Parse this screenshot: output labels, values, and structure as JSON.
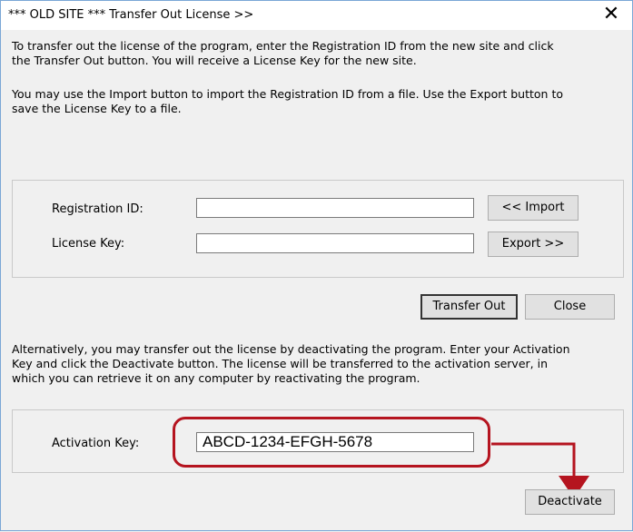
{
  "window": {
    "title": "*** OLD SITE ***  Transfer Out License >>",
    "close_glyph": "✕"
  },
  "intro": {
    "line1": "To transfer out the license of the program, enter the Registration ID from the new site and click",
    "line2": "the Transfer Out button. You will receive a License Key for the new site.",
    "line3": "You may use the Import button to import the Registration ID from a file. Use the Export button to",
    "line4": "save the License Key to a file."
  },
  "transfer_group": {
    "registration_label": "Registration ID:",
    "registration_value": "",
    "license_label": "License Key:",
    "license_value": "",
    "import_label": "<< Import",
    "export_label": "Export >>"
  },
  "actions": {
    "transfer_out_label": "Transfer Out",
    "close_label": "Close"
  },
  "alternative": {
    "line1": "Alternatively, you may transfer out the license by deactivating the program. Enter your Activation",
    "line2": "Key and click the Deactivate button. The license will be transferred to the activation server, in",
    "line3": "which you can retrieve it on any computer by reactivating the program."
  },
  "activation_group": {
    "activation_label": "Activation Key:",
    "activation_value": "ABCD-1234-EFGH-5678"
  },
  "deactivate_label": "Deactivate",
  "colors": {
    "annotation": "#b5141f",
    "window_border": "#7aa7d6"
  }
}
